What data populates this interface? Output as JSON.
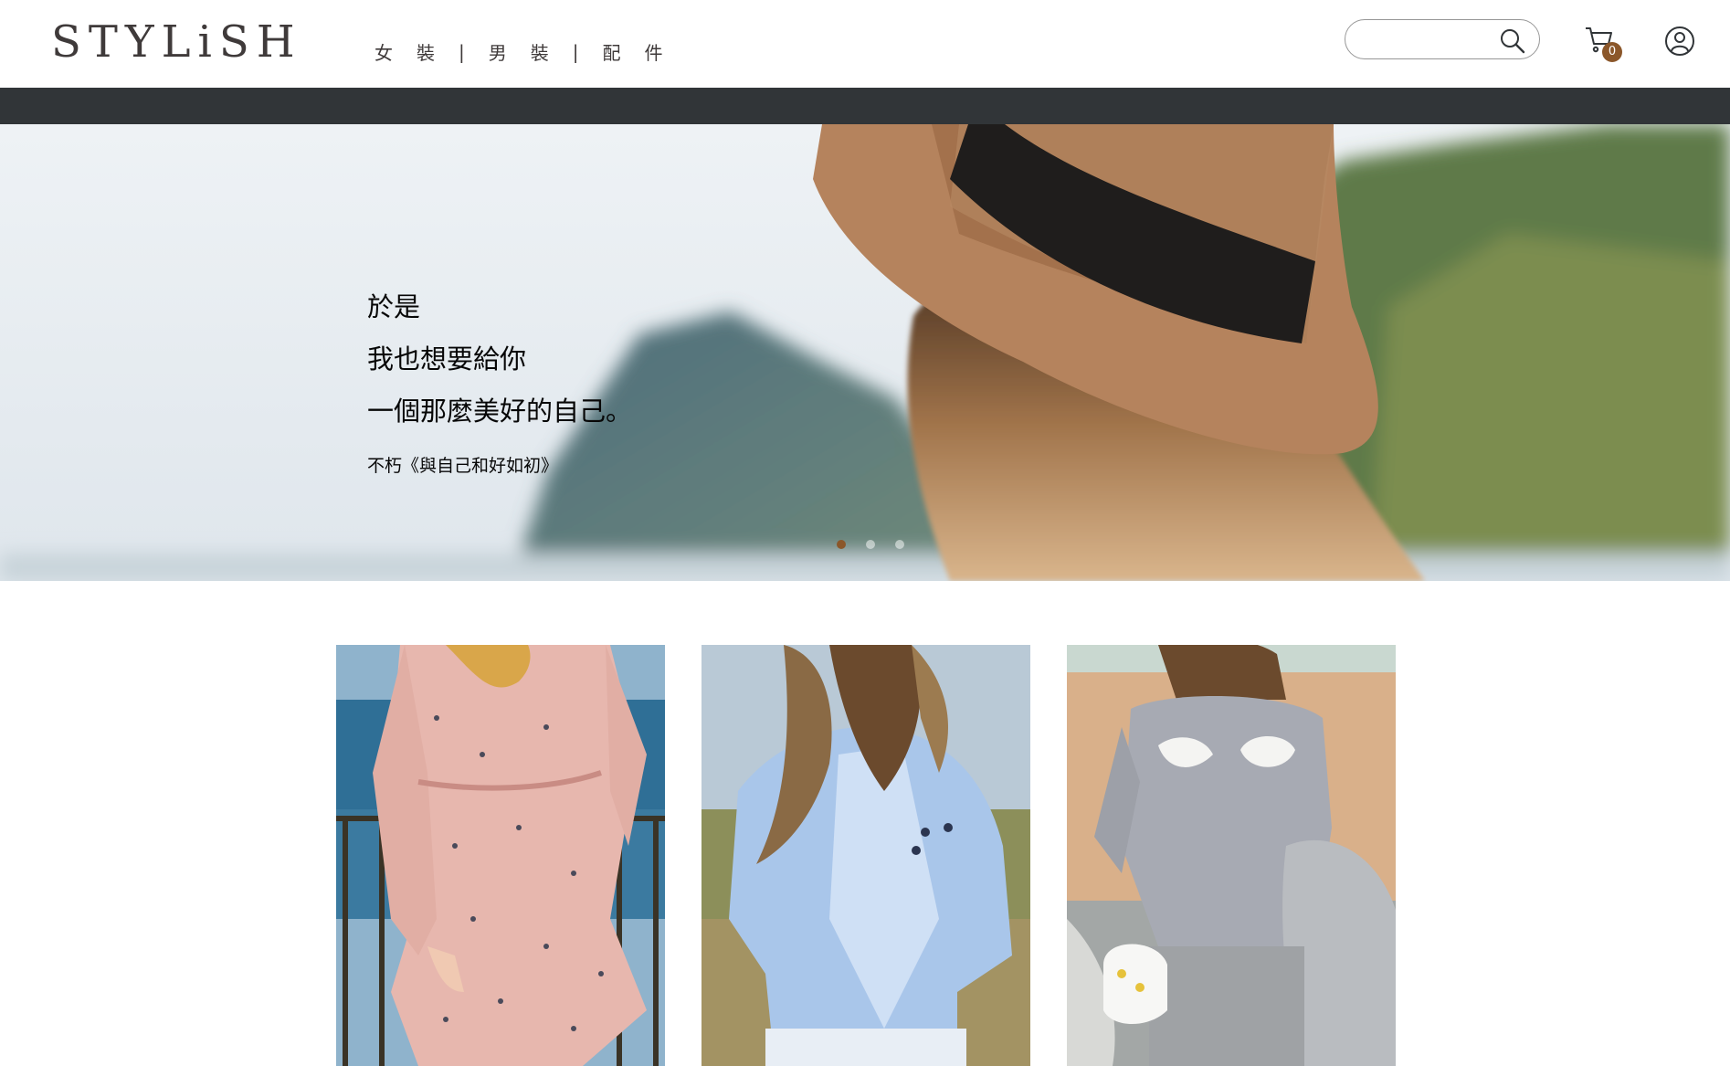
{
  "header": {
    "logo": "STYLiSH",
    "nav": [
      {
        "label": "女裝"
      },
      {
        "label": "男裝"
      },
      {
        "label": "配件"
      }
    ],
    "nav_separator": "|",
    "search": {
      "placeholder": "",
      "value": "",
      "icon": "search-icon"
    },
    "cart": {
      "icon": "cart-icon",
      "count": "0"
    },
    "member": {
      "icon": "member-icon"
    }
  },
  "hero": {
    "lines": [
      "於是",
      "我也想要給你",
      "一個那麼美好的自己。"
    ],
    "source": "不朽《與自己和好如初》",
    "dots": [
      {
        "active": true
      },
      {
        "active": false
      },
      {
        "active": false
      }
    ]
  },
  "products": [
    {
      "image": "pink-bird-print-wrap-dress"
    },
    {
      "image": "light-blue-blouse"
    },
    {
      "image": "grey-blouse-with-shell-patches"
    }
  ],
  "colors": {
    "brand": "#3f3a3a",
    "dark_bar": "#313538",
    "accent": "#8b572a"
  }
}
